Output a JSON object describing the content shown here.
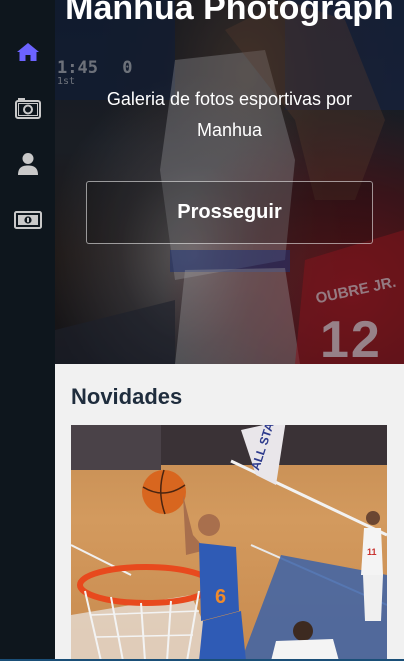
{
  "sidebar": {
    "items": [
      {
        "name": "home",
        "icon": "home-icon",
        "active": true
      },
      {
        "name": "photos",
        "icon": "camera-icon",
        "active": false
      },
      {
        "name": "profile",
        "icon": "user-icon",
        "active": false
      },
      {
        "name": "payment",
        "icon": "money-icon",
        "active": false
      }
    ],
    "active_color": "#6c63ff",
    "icon_color": "#c9c9c9"
  },
  "hero": {
    "title": "Manhua Photograph",
    "subtitle": "Galeria de fotos esportivas por Manhua",
    "button_label": "Prosseguir",
    "photo_text": {
      "clock": "1:45",
      "period": "1st",
      "score": "0",
      "jersey_name": "OUBRE JR.",
      "jersey_number": "12"
    }
  },
  "news": {
    "title": "Novidades",
    "photo_text": {
      "banner": "ALL STAR",
      "player1_number": "6",
      "player2_number": "11"
    }
  }
}
